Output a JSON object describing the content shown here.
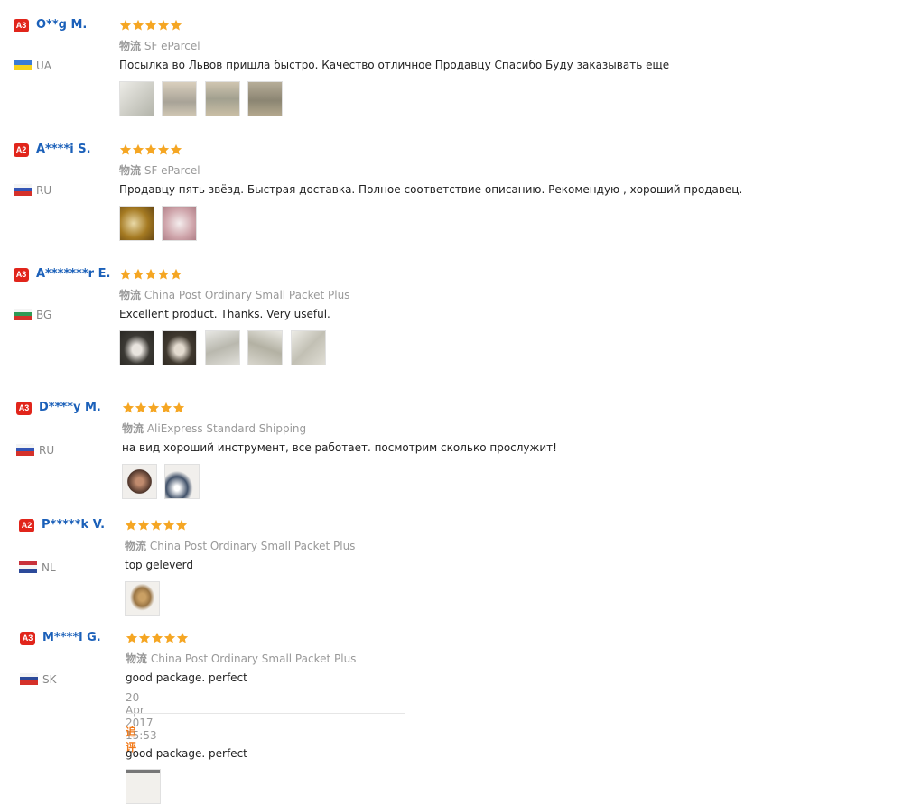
{
  "colors": {
    "star": "#f5a623",
    "buyer_name": "#1b60b9",
    "level_badge": "#e1251b",
    "additional_label": "#f27a1a"
  },
  "reviews": [
    {
      "level": "A3",
      "name": "O**g M.",
      "country": "UA",
      "flag": "ua",
      "rating": 5,
      "ship_prefix": "物流",
      "shipping": "SF eParcel",
      "text": "Посылка во Львов пришла быстро. Качество отличное Продавцу Спасибо Буду заказывать еще",
      "photos": 4
    },
    {
      "level": "A2",
      "name": "A****i S.",
      "country": "RU",
      "flag": "ru",
      "rating": 5,
      "ship_prefix": "物流",
      "shipping": "SF eParcel",
      "text": "Продавцу пять звёзд. Быстрая доставка. Полное соответствие описанию. Рекомендую , хороший продавец.",
      "photos": 2
    },
    {
      "level": "A3",
      "name": "A*******r E.",
      "country": "BG",
      "flag": "bg",
      "rating": 5,
      "ship_prefix": "物流",
      "shipping": "China Post Ordinary Small Packet Plus",
      "text": "Excellent product. Thanks. Very useful.",
      "photos": 5
    },
    {
      "level": "A3",
      "name": "D****y M.",
      "country": "RU",
      "flag": "ru",
      "rating": 5,
      "ship_prefix": "物流",
      "shipping": "AliExpress Standard Shipping",
      "text": "на вид хороший инструмент, все работает. посмотрим сколько прослужит!",
      "photos": 2
    },
    {
      "level": "A2",
      "name": "P*****k V.",
      "country": "NL",
      "flag": "nl",
      "rating": 5,
      "ship_prefix": "物流",
      "shipping": "China Post Ordinary Small Packet Plus",
      "text": "top geleverd",
      "photos": 1
    },
    {
      "level": "A3",
      "name": "M****l G.",
      "country": "SK",
      "flag": "sk",
      "rating": 5,
      "ship_prefix": "物流",
      "shipping": "China Post Ordinary Small Packet Plus",
      "text": "good package. perfect",
      "date": "20 Apr 2017 15:53",
      "additional_label": "追评",
      "additional_text": "good package. perfect",
      "photos": 1
    }
  ]
}
